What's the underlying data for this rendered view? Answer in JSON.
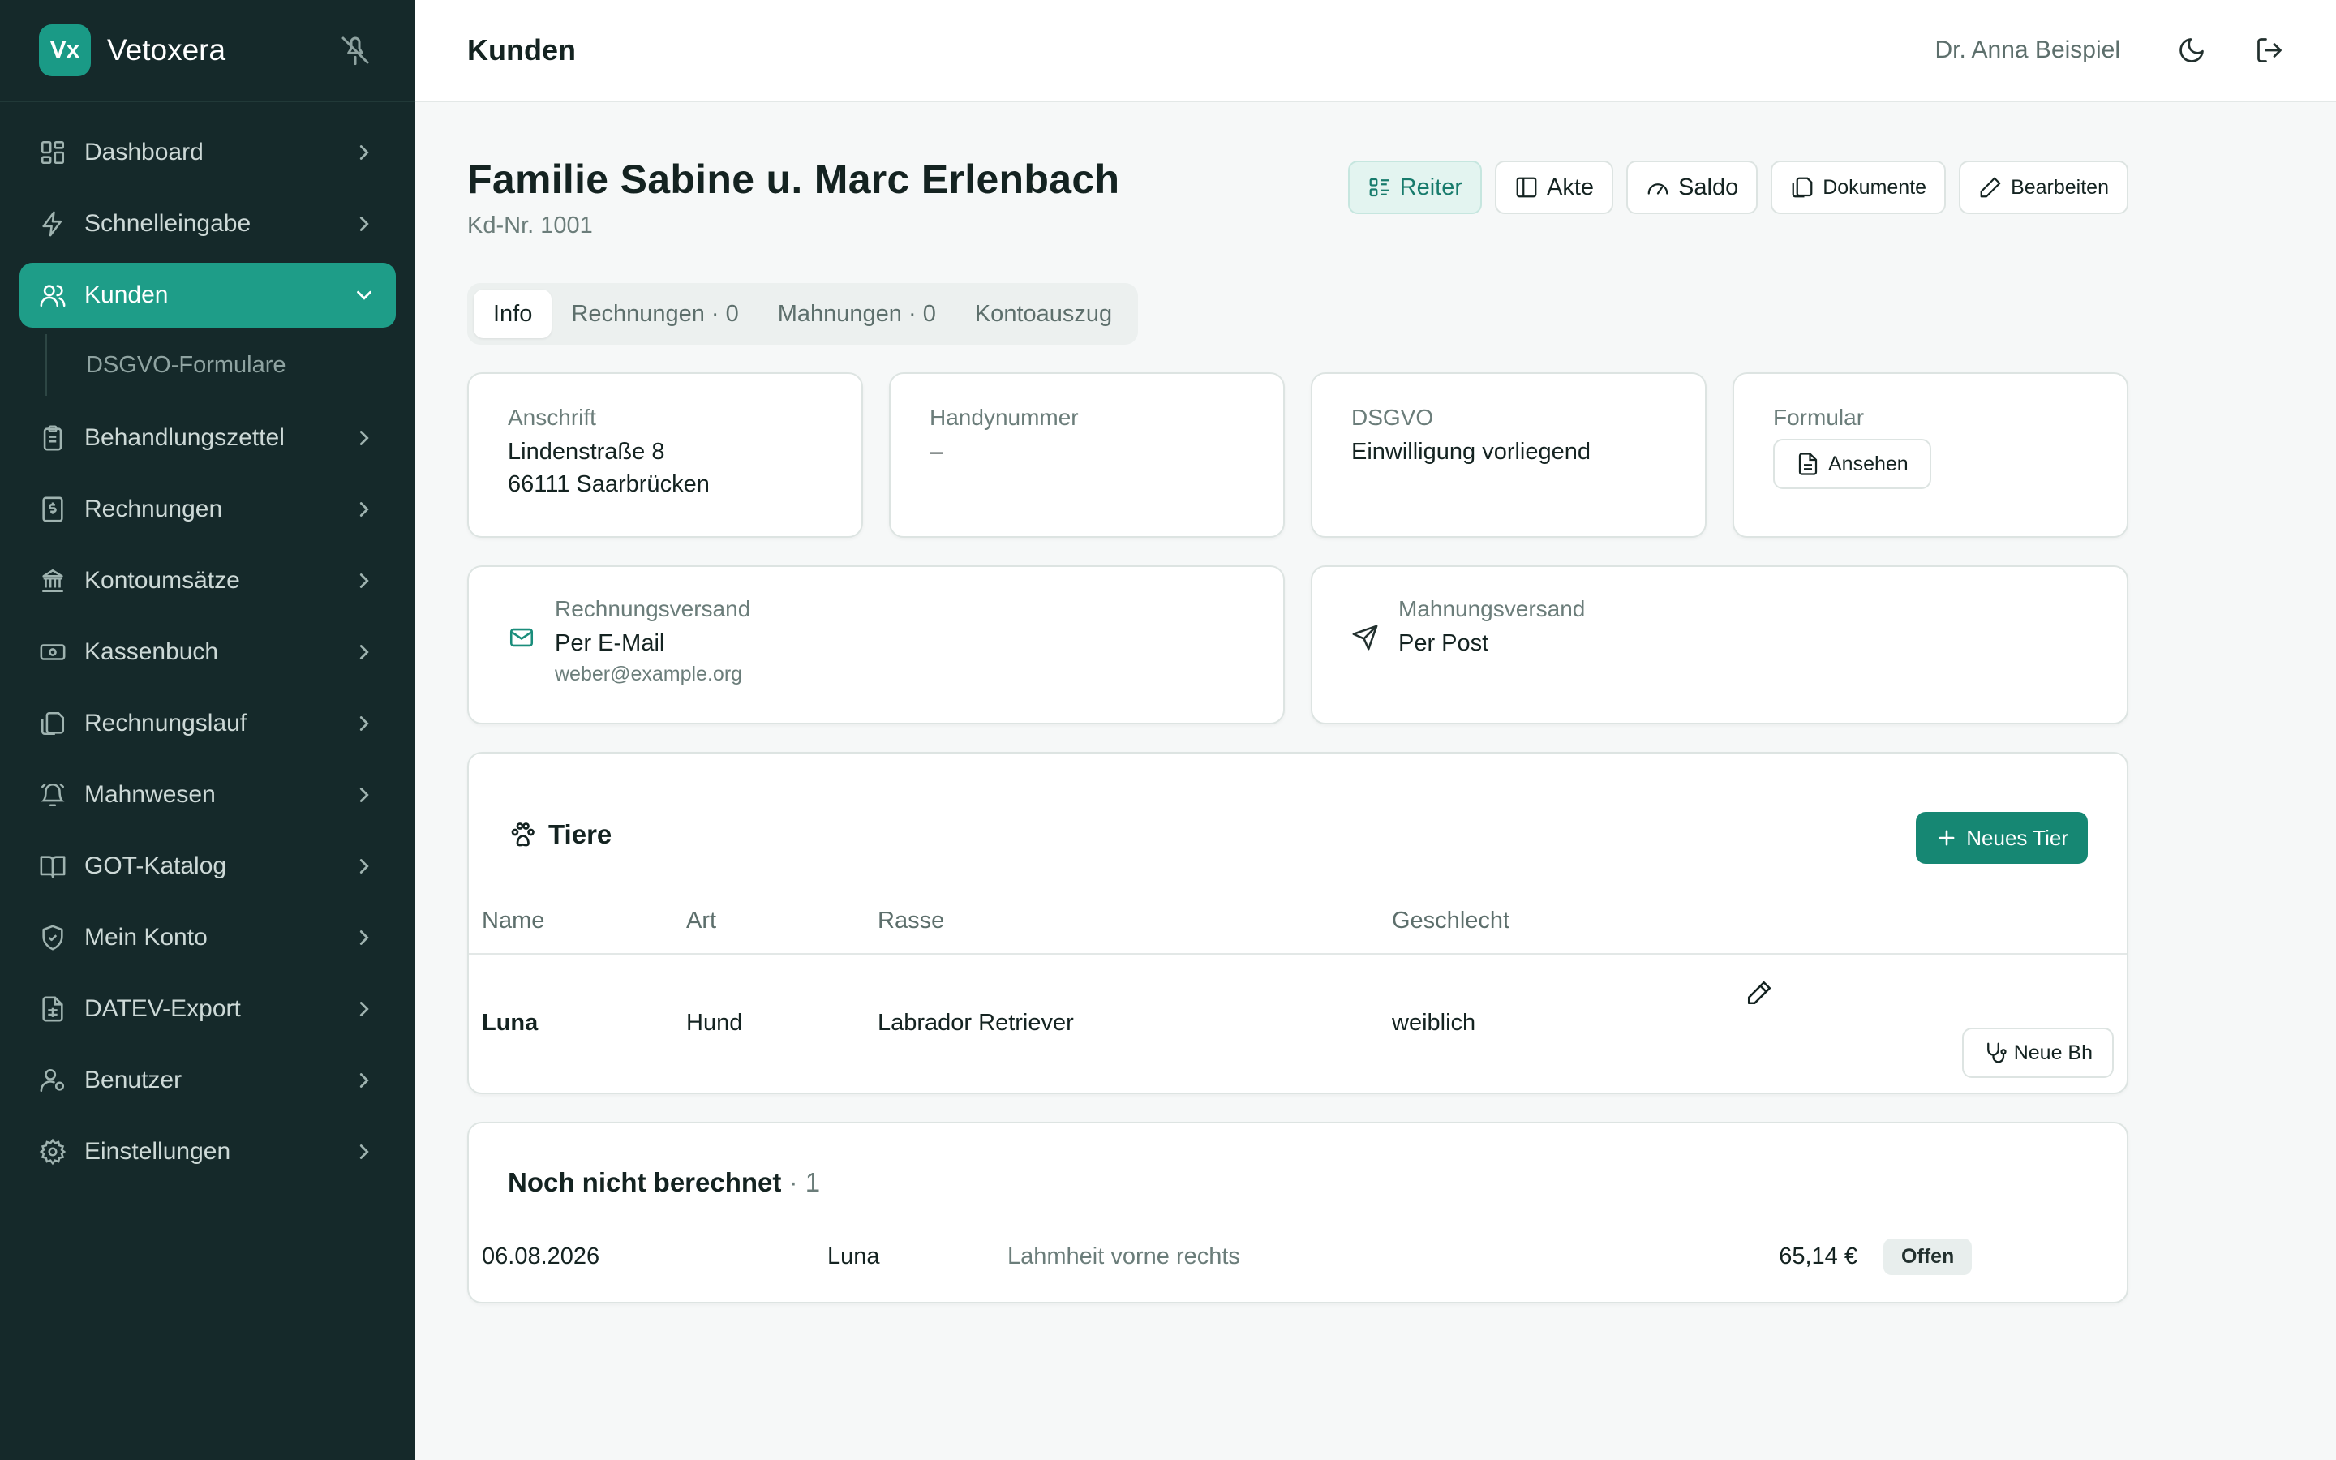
{
  "app": {
    "logo": "Vx",
    "name": "Vetoxera"
  },
  "sidebar": {
    "items": [
      {
        "label": "Dashboard",
        "icon": "dashboard-icon"
      },
      {
        "label": "Schnelleingabe",
        "icon": "lightning-icon"
      },
      {
        "label": "Kunden",
        "icon": "users-icon",
        "active": true,
        "sub": "DSGVO-Formulare"
      },
      {
        "label": "Behandlungszettel",
        "icon": "clipboard-icon"
      },
      {
        "label": "Rechnungen",
        "icon": "receipt-icon"
      },
      {
        "label": "Kontoumsätze",
        "icon": "bank-icon"
      },
      {
        "label": "Kassenbuch",
        "icon": "cash-icon"
      },
      {
        "label": "Rechnungslauf",
        "icon": "files-icon"
      },
      {
        "label": "Mahnwesen",
        "icon": "bell-icon"
      },
      {
        "label": "GOT-Katalog",
        "icon": "book-icon"
      },
      {
        "label": "Mein Konto",
        "icon": "shield-icon"
      },
      {
        "label": "DATEV-Export",
        "icon": "sheet-icon"
      },
      {
        "label": "Benutzer",
        "icon": "user-gear-icon"
      },
      {
        "label": "Einstellungen",
        "icon": "gear-icon"
      }
    ]
  },
  "header": {
    "title": "Kunden",
    "user": "Dr. Anna Beispiel"
  },
  "customer": {
    "name": "Familie Sabine u. Marc Erlenbach",
    "kdnr": "Kd-Nr. 1001"
  },
  "actions": {
    "reiter": "Reiter",
    "akte": "Akte",
    "saldo": "Saldo",
    "dokumente": "Dokumente",
    "bearbeiten": "Bearbeiten"
  },
  "tabs": [
    "Info",
    "Rechnungen · 0",
    "Mahnungen · 0",
    "Kontoauszug"
  ],
  "info": {
    "anschrift_label": "Anschrift",
    "street": "Lindenstraße 8",
    "city": "66111 Saarbrücken",
    "handy_label": "Handynummer",
    "handy": "–",
    "dsgvo_label": "DSGVO",
    "dsgvo": "Einwilligung vorliegend",
    "formular_label": "Formular",
    "formular_button": "Ansehen"
  },
  "versand": {
    "rechnung_label": "Rechnungsversand",
    "rechnung": "Per E-Mail",
    "email": "weber@example.org",
    "mahnung_label": "Mahnungsversand",
    "mahnung": "Per Post"
  },
  "tiere": {
    "title": "Tiere",
    "new_button": "Neues Tier",
    "columns": [
      "Name",
      "Art",
      "Rasse",
      "Geschlecht"
    ],
    "rows": [
      {
        "name": "Luna",
        "art": "Hund",
        "rasse": "Labrador Retriever",
        "geschlecht": "weiblich",
        "button": "Neue Bh"
      }
    ]
  },
  "unbilled": {
    "title": "Noch nicht berechnet",
    "count": "· 1",
    "rows": [
      {
        "date": "06.08.2026",
        "tier": "Luna",
        "desc": "Lahmheit vorne rechts",
        "amount": "65,14 €",
        "status": "Offen"
      }
    ]
  },
  "colors": {
    "accent": "#1e9d88",
    "sidebar": "#15292a",
    "page": "#f6f8f8"
  }
}
